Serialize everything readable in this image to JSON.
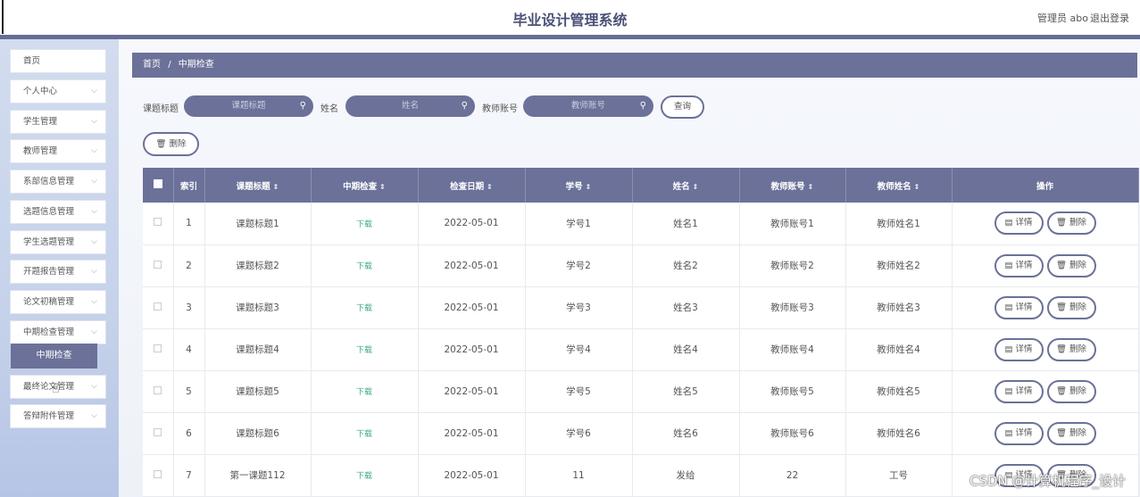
{
  "app": {
    "title": "毕业设计管理系统",
    "user": "管理员 abo",
    "logout": "退出登录"
  },
  "sidebar": {
    "items": [
      {
        "label": "首页",
        "chevron": false
      },
      {
        "label": "个人中心",
        "chevron": true
      },
      {
        "label": "学生管理",
        "chevron": true
      },
      {
        "label": "教师管理",
        "chevron": true
      },
      {
        "label": "系部信息管理",
        "chevron": true
      },
      {
        "label": "选题信息管理",
        "chevron": true
      },
      {
        "label": "学生选题管理",
        "chevron": true
      },
      {
        "label": "开题报告管理",
        "chevron": true
      },
      {
        "label": "论文初稿管理",
        "chevron": true
      },
      {
        "label": "中期检查管理",
        "chevron": true
      },
      {
        "label": "最终论文管理",
        "chevron": true
      },
      {
        "label": "答辩附件管理",
        "chevron": true
      }
    ],
    "active_sub": "中期检查"
  },
  "breadcrumb": {
    "home": "首页",
    "sep": "/",
    "current": "中期检查"
  },
  "search": {
    "title_label": "课题标题",
    "title_placeholder": "课题标题",
    "name_label": "姓名",
    "name_placeholder": "姓名",
    "teacher_label": "教师账号",
    "teacher_placeholder": "教师账号",
    "query": "查询"
  },
  "toolbar": {
    "delete": "删除"
  },
  "table": {
    "headers": [
      "索引",
      "课题标题",
      "中期检查",
      "检查日期",
      "学号",
      "姓名",
      "教师账号",
      "教师姓名",
      "操作"
    ],
    "rows": [
      [
        "1",
        "课题标题1",
        "下载",
        "2022-05-01",
        "学号1",
        "姓名1",
        "教师账号1",
        "教师姓名1"
      ],
      [
        "2",
        "课题标题2",
        "下载",
        "2022-05-01",
        "学号2",
        "姓名2",
        "教师账号2",
        "教师姓名2"
      ],
      [
        "3",
        "课题标题3",
        "下载",
        "2022-05-01",
        "学号3",
        "姓名3",
        "教师账号3",
        "教师姓名3"
      ],
      [
        "4",
        "课题标题4",
        "下载",
        "2022-05-01",
        "学号4",
        "姓名4",
        "教师账号4",
        "教师姓名4"
      ],
      [
        "5",
        "课题标题5",
        "下载",
        "2022-05-01",
        "学号5",
        "姓名5",
        "教师账号5",
        "教师姓名5"
      ],
      [
        "6",
        "课题标题6",
        "下载",
        "2022-05-01",
        "学号6",
        "姓名6",
        "教师账号6",
        "教师姓名6"
      ],
      [
        "7",
        "第一课题112",
        "下载",
        "2022-05-01",
        "11",
        "发给",
        "22",
        "工号"
      ]
    ],
    "detail": "详情",
    "delete": "删除"
  },
  "watermark": "CSDN @计算机程序_设计",
  "colors": {
    "accent": "#6b7198",
    "download": "#3aa88a"
  }
}
